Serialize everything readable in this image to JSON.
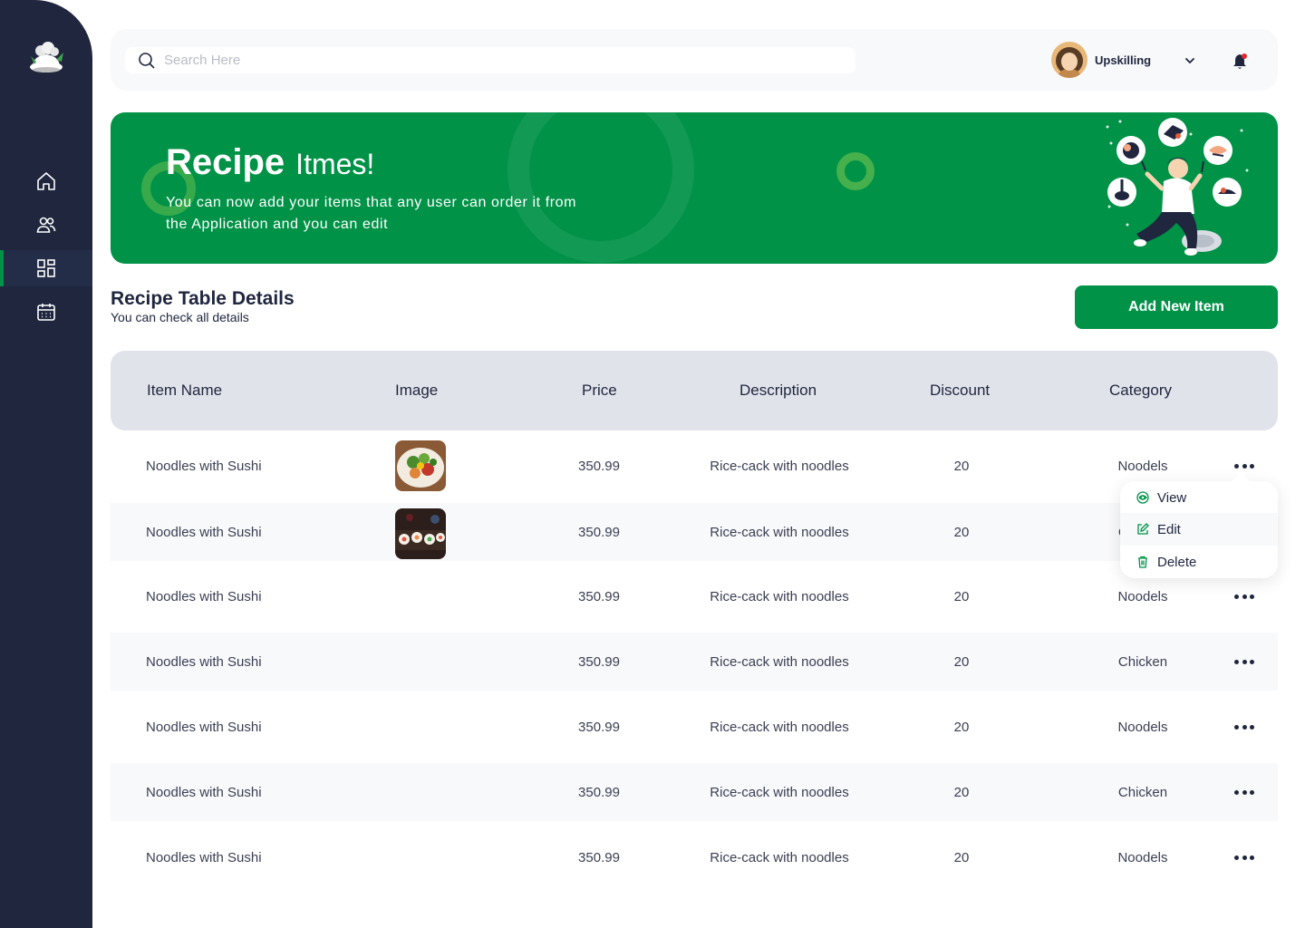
{
  "sidebar": {
    "logo_icon": "chef-hat-icon",
    "items": [
      {
        "name": "home",
        "icon": "home-icon",
        "active": false
      },
      {
        "name": "users",
        "icon": "users-icon",
        "active": false
      },
      {
        "name": "recipes",
        "icon": "grid-icon",
        "active": true
      },
      {
        "name": "calendar",
        "icon": "calendar-icon",
        "active": false
      }
    ]
  },
  "header": {
    "search_placeholder": "Search Here",
    "user_name": "Upskilling"
  },
  "banner": {
    "title_bold": "Recipe",
    "title_light": "Itmes!",
    "subtitle": "You can now add your items that any user can order it from the Application and you can edit"
  },
  "section": {
    "title": "Recipe Table Details",
    "subtitle": "You can check all details",
    "add_button": "Add New Item"
  },
  "table": {
    "headers": [
      "Item Name",
      "Image",
      "Price",
      "Description",
      "Discount",
      "Category"
    ],
    "rows": [
      {
        "name": "Noodles with Sushi",
        "image": "salad",
        "price": "350.99",
        "description": "Rice-cack with noodles",
        "discount": "20",
        "category": "Noodels"
      },
      {
        "name": "Noodles with Sushi",
        "image": "sushi",
        "price": "350.99",
        "description": "Rice-cack with noodles",
        "discount": "20",
        "category": "Chicken"
      },
      {
        "name": "Noodles with Sushi",
        "image": "",
        "price": "350.99",
        "description": "Rice-cack with noodles",
        "discount": "20",
        "category": "Noodels"
      },
      {
        "name": "Noodles with Sushi",
        "image": "",
        "price": "350.99",
        "description": "Rice-cack with noodles",
        "discount": "20",
        "category": "Chicken"
      },
      {
        "name": "Noodles with Sushi",
        "image": "",
        "price": "350.99",
        "description": "Rice-cack with noodles",
        "discount": "20",
        "category": "Noodels"
      },
      {
        "name": "Noodles with Sushi",
        "image": "",
        "price": "350.99",
        "description": "Rice-cack with noodles",
        "discount": "20",
        "category": "Chicken"
      },
      {
        "name": "Noodles with Sushi",
        "image": "",
        "price": "350.99",
        "description": "Rice-cack with noodles",
        "discount": "20",
        "category": "Noodels"
      }
    ]
  },
  "menu": {
    "items": [
      {
        "label": "View",
        "icon": "eye-icon"
      },
      {
        "label": "Edit",
        "icon": "edit-icon"
      },
      {
        "label": "Delete",
        "icon": "trash-icon"
      }
    ]
  },
  "colors": {
    "sidebar": "#1f263e",
    "brand_green": "#009247",
    "table_header": "#e1e3eb",
    "row_alt": "#f8f9fb"
  }
}
